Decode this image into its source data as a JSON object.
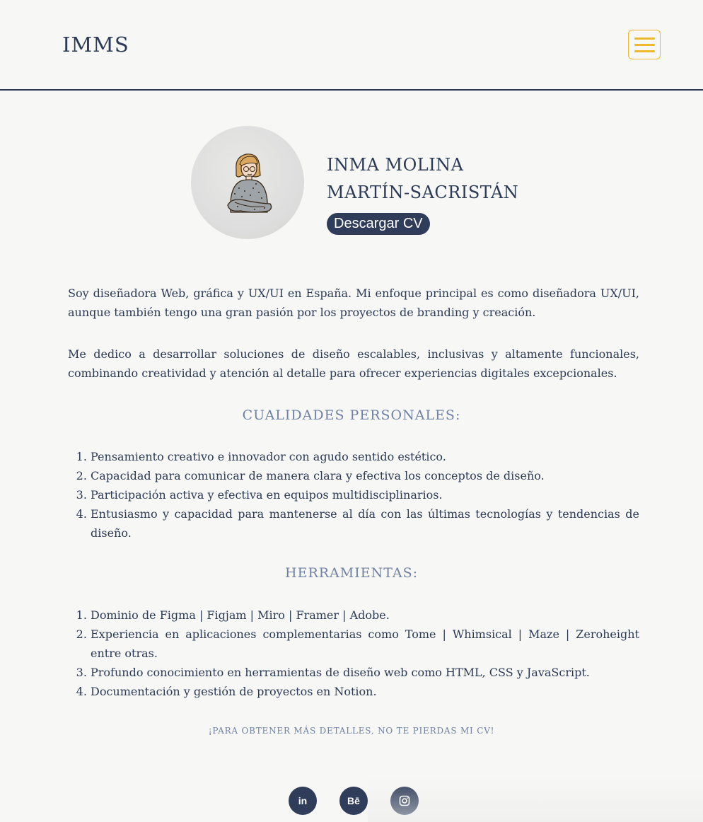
{
  "header": {
    "brand": "IMMS",
    "menu_icon": "hamburger-menu-icon",
    "accent_color": "#f0b82c"
  },
  "profile": {
    "name_line1": "INMA MOLINA",
    "name_line2": "MARTÍN-SACRISTÁN",
    "cv_button": "Descargar CV"
  },
  "about": {
    "paragraph1": "Soy diseñadora Web, gráfica y UX/UI en España. Mi enfoque principal es como diseñadora UX/UI, aunque también tengo una gran pasión por los proyectos de branding y creación.",
    "paragraph2": "Me dedico a desarrollar soluciones de diseño escalables, inclusivas y altamente funcionales, combinando creatividad y atención al detalle para ofrecer experiencias digitales excepcionales."
  },
  "qualities": {
    "title": "CUALIDADES PERSONALES:",
    "items": [
      "Pensamiento creativo e innovador con agudo sentido estético.",
      "Capacidad para comunicar de manera clara y efectiva los conceptos de diseño.",
      "Participación activa y efectiva en equipos multidisciplinarios.",
      "Entusiasmo y capacidad para mantenerse al día con las últimas tecnologías y tendencias de diseño."
    ]
  },
  "tools": {
    "title": "HERRAMIENTAS:",
    "items": [
      "Dominio de Figma | Figjam | Miro | Framer | Adobe.",
      "Experiencia en aplicaciones complementarias como Tome | Whimsical | Maze | Zeroheight entre otras.",
      "Profundo conocimiento en herramientas de diseño web como HTML, CSS y JavaScript.",
      "Documentación y gestión de proyectos en Notion."
    ]
  },
  "cta": "¡PARA OBTENER MÁS DETALLES, NO TE PIERDAS MI CV!",
  "social": {
    "linkedin": "in",
    "behance": "Bē",
    "instagram_icon": "instagram-icon"
  },
  "colors": {
    "primary": "#2a3a57",
    "section_title": "#6f82a6",
    "background": "#f7f7f5"
  }
}
